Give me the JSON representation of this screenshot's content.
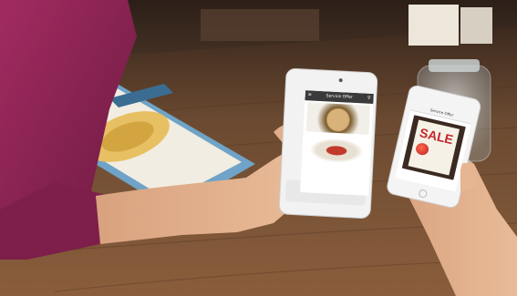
{
  "scene": {
    "left_phone": {
      "header_title": "Service Offer",
      "menu_icon": "hamburger-icon",
      "pin_icon": "location-pin-icon"
    },
    "right_phone": {
      "header_title": "Service Offer",
      "sale_text": "SALE"
    }
  },
  "colors": {
    "wood": "#6b4a31",
    "accent_red": "#c1272d",
    "sleeve": "#8e2453"
  }
}
